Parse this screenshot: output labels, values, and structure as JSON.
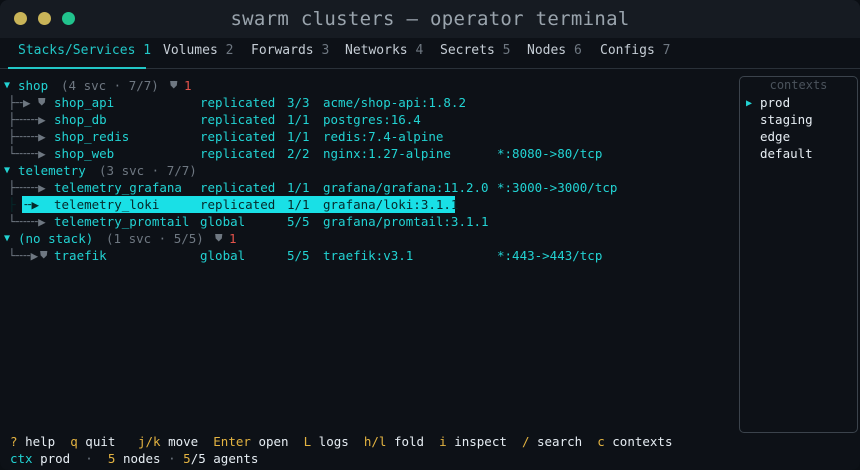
{
  "window": {
    "title": "swarm clusters — operator terminal"
  },
  "tabs": [
    {
      "label": "Stacks/Services",
      "num": "1"
    },
    {
      "label": "Volumes",
      "num": "2"
    },
    {
      "label": "Forwards",
      "num": "3"
    },
    {
      "label": "Networks",
      "num": "4"
    },
    {
      "label": "Secrets",
      "num": "5"
    },
    {
      "label": "Nodes",
      "num": "6"
    },
    {
      "label": "Configs",
      "num": "7"
    }
  ],
  "stacks": [
    {
      "name": "shop",
      "summary": "(4 svc · 7/7)",
      "alert": "1",
      "services": [
        {
          "name": "shop_api",
          "mode": "replicated",
          "replicas": "3/3",
          "image": "acme/shop-api:1.8.2",
          "ports": ""
        },
        {
          "name": "shop_db",
          "mode": "replicated",
          "replicas": "1/1",
          "image": "postgres:16.4",
          "ports": ""
        },
        {
          "name": "shop_redis",
          "mode": "replicated",
          "replicas": "1/1",
          "image": "redis:7.4-alpine",
          "ports": ""
        },
        {
          "name": "shop_web",
          "mode": "replicated",
          "replicas": "2/2",
          "image": "nginx:1.27-alpine",
          "ports": "*:8080->80/tcp"
        }
      ]
    },
    {
      "name": "telemetry",
      "summary": "(3 svc · 7/7)",
      "services": [
        {
          "name": "telemetry_grafana",
          "mode": "replicated",
          "replicas": "1/1",
          "image": "grafana/grafana:11.2.0",
          "ports": "*:3000->3000/tcp"
        },
        {
          "name": "telemetry_loki",
          "mode": "replicated",
          "replicas": "1/1",
          "image": "grafana/loki:3.1.1",
          "ports": ""
        },
        {
          "name": "telemetry_promtail",
          "mode": "global",
          "replicas": "5/5",
          "image": "grafana/promtail:3.1.1",
          "ports": ""
        }
      ]
    },
    {
      "name": "(no stack)",
      "summary": "(1 svc · 5/5)",
      "alert": "1",
      "services": [
        {
          "name": "traefik",
          "mode": "global",
          "replicas": "5/5",
          "image": "traefik:v3.1",
          "ports": "*:443->443/tcp"
        }
      ]
    }
  ],
  "contexts": {
    "title": "contexts",
    "items": [
      "prod",
      "staging",
      "edge",
      "default"
    ]
  },
  "help": [
    {
      "key": "?",
      "label": "help"
    },
    {
      "key": "q",
      "label": "quit"
    },
    {
      "key": "j/k",
      "label": "move"
    },
    {
      "key": "Enter",
      "label": "open"
    },
    {
      "key": "L",
      "label": "logs"
    },
    {
      "key": "h/l",
      "label": "fold"
    },
    {
      "key": "i",
      "label": "inspect"
    },
    {
      "key": "/",
      "label": "search"
    },
    {
      "key": "c",
      "label": "contexts"
    }
  ],
  "status": {
    "ctx_label": "ctx",
    "ctx_value": "prod",
    "nodes_count": "5",
    "nodes_label": "nodes",
    "agents_count": "5",
    "agents_total": "/5 agents"
  }
}
